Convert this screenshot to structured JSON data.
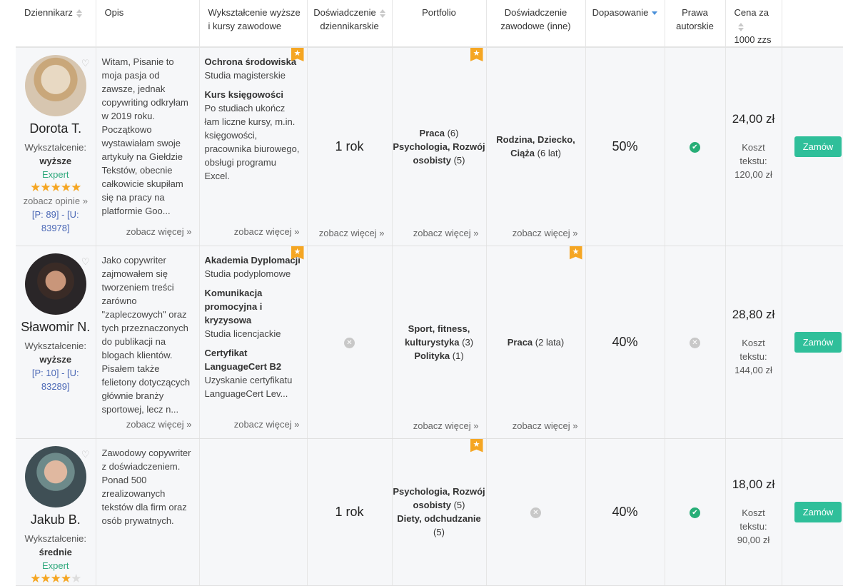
{
  "headers": {
    "dziennikarz": "Dziennikarz",
    "opis": "Opis",
    "wyksztalcenie_1": "Wykształcenie wyższe",
    "wyksztalcenie_2": "i kursy zawodowe",
    "doswiadczenie_dz_1": "Doświadczenie",
    "doswiadczenie_dz_2": "dziennikarskie",
    "portfolio": "Portfolio",
    "doswiadczenie_z_1": "Doświadczenie",
    "doswiadczenie_z_2": "zawodowe (inne)",
    "dopasowanie": "Dopasowanie",
    "prawa_1": "Prawa",
    "prawa_2": "autorskie",
    "cena_1": "Cena za",
    "cena_2": "1000 zzs"
  },
  "labels": {
    "edu_label": "Wykształcenie:",
    "see_more": "zobacz więcej »",
    "see_opinions": "zobacz opinie »",
    "cost_1": "Koszt",
    "cost_2": "tekstu:",
    "order": "Zamów",
    "expert": "Expert"
  },
  "colors": {
    "accent": "#2fbf9a",
    "star": "#f5a623",
    "link": "#4a67b5",
    "check": "#27ae77"
  },
  "rows": [
    {
      "name": "Dorota T.",
      "education": "wyższe",
      "rating_stars": 5,
      "pu_1": "[P: 89] - [U:",
      "pu_2": "83978]",
      "description": "Witam, Pisanie to moja pasja od zawsze, jednak copywriting odkryłam w 2019 roku. Początkowo wystawiałam swoje artykuły na Giełdzie Tekstów, obecnie całkowicie skupiłam się na pracy na platformie Goo...",
      "edu_items": [
        {
          "title": "Ochrona środowiska",
          "sub": "Studia magisterskie"
        },
        {
          "title": "Kurs księgowości",
          "sub": "Po studiach ukończ łam liczne kursy, m.in. księgowości, pracownika biurowego, obsługi programu Excel."
        }
      ],
      "journalism": "1 rok",
      "portfolio": [
        {
          "bold": "Praca",
          "count": "(6)"
        },
        {
          "bold": "Psychologia, Rozwój osobisty",
          "count": "(5)"
        }
      ],
      "other_exp": [
        {
          "bold": "Rodzina, Dziecko, Ciąża",
          "count": "(6 lat)"
        }
      ],
      "match": "50%",
      "price": "24,00 zł",
      "cost": "120,00 zł"
    },
    {
      "name": "Sławomir N.",
      "education": "wyższe",
      "pu_1": "[P: 10] - [U:",
      "pu_2": "83289]",
      "description": "Jako copywriter zajmowałem się tworzeniem treści zarówno \"zapleczowych\" oraz tych przeznaczonych do publikacji na blogach klientów. Pisałem także felietony dotyczących głównie branży sportowej, lecz n...",
      "edu_items": [
        {
          "title": "Akademia Dyplomacji",
          "sub": "Studia podyplomowe"
        },
        {
          "title": "Komunikacja promocyjna i kryzysowa",
          "sub": "Studia licencjackie"
        },
        {
          "title": "Certyfikat LanguageCert B2",
          "sub": "Uzyskanie certyfikatu LanguageCert Lev..."
        }
      ],
      "portfolio": [
        {
          "bold": "Sport, fitness, kulturystyka",
          "count": "(3)"
        },
        {
          "bold": "Polityka",
          "count": "(1)"
        }
      ],
      "other_exp": [
        {
          "bold": "Praca",
          "count": "(2 lata)"
        }
      ],
      "match": "40%",
      "price": "28,80 zł",
      "cost": "144,00 zł"
    },
    {
      "name": "Jakub B.",
      "education": "średnie",
      "rating_stars": 4,
      "description": "Zawodowy copywriter z doświadczeniem. Ponad 500 zrealizowanych tekstów dla firm oraz osób prywatnych.",
      "journalism": "1 rok",
      "portfolio": [
        {
          "bold": "Psychologia, Rozwój osobisty",
          "count": "(5)"
        },
        {
          "bold": "Diety, odchudzanie",
          "count": "(5)"
        }
      ],
      "match": "40%",
      "price": "18,00 zł",
      "cost": "90,00 zł"
    }
  ]
}
